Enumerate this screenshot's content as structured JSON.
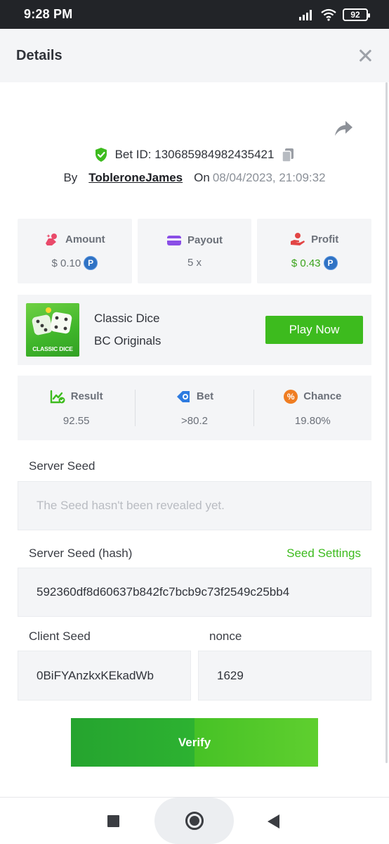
{
  "status_bar": {
    "time": "9:28 PM",
    "battery": "92"
  },
  "header": {
    "title": "Details"
  },
  "bet": {
    "id_label": "Bet ID: 130685984982435421",
    "by": "By",
    "user": "TobleroneJames",
    "on": "On",
    "date": "08/04/2023, 21:09:32"
  },
  "stats": {
    "amount": {
      "label": "Amount",
      "value": "$ 0.10"
    },
    "payout": {
      "label": "Payout",
      "value": "5 x"
    },
    "profit": {
      "label": "Profit",
      "value": "$ 0.43"
    }
  },
  "coin_symbol": "P",
  "game": {
    "thumb_text": "CLASSIC DICE",
    "name": "Classic Dice",
    "provider": "BC Originals",
    "play_label": "Play Now"
  },
  "result": {
    "result": {
      "label": "Result",
      "value": "92.55"
    },
    "bet": {
      "label": "Bet",
      "value": ">80.2"
    },
    "chance": {
      "label": "Chance",
      "value": "19.80%",
      "icon_text": "%"
    }
  },
  "seeds": {
    "server_seed_label": "Server Seed",
    "server_seed_value": "The Seed hasn't been revealed yet.",
    "server_hash_label": "Server Seed (hash)",
    "seed_settings": "Seed Settings",
    "server_hash_value": "592360df8d60637b842fc7bcb9c73f2549c25bb4",
    "client_seed_label": "Client Seed",
    "client_seed_value": "0BiFYAnzkxKEkadWb",
    "nonce_label": "nonce",
    "nonce_value": "1629"
  },
  "verify_label": "Verify",
  "colors": {
    "accent_green": "#3dbb1e",
    "card_bg": "#f4f5f7",
    "coin_blue": "#2f72c4"
  }
}
